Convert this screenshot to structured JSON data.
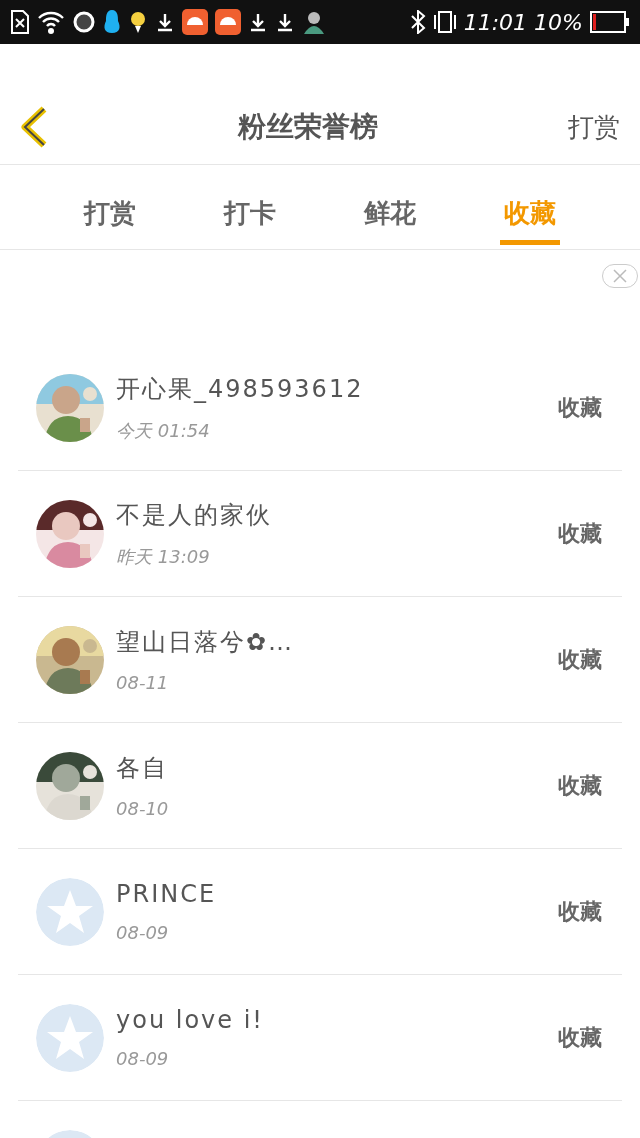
{
  "status_bar": {
    "time": "11:01",
    "battery_text": "10%"
  },
  "header": {
    "title": "粉丝荣誉榜",
    "action": "打赏"
  },
  "tabs": [
    {
      "label": "打赏",
      "selected": false
    },
    {
      "label": "打卡",
      "selected": false
    },
    {
      "label": "鲜花",
      "selected": false
    },
    {
      "label": "收藏",
      "selected": true
    }
  ],
  "fans": [
    {
      "name": "开心果_498593612",
      "time": "今天 01:54",
      "action": "收藏"
    },
    {
      "name": "不是人的家伙",
      "time": "昨天 13:09",
      "action": "收藏"
    },
    {
      "name": "望山日落兮✿…",
      "time": "08-11",
      "action": "收藏"
    },
    {
      "name": "各自",
      "time": "08-10",
      "action": "收藏"
    },
    {
      "kind": "default",
      "name": "PRINCE",
      "time": "08-09",
      "action": "收藏"
    },
    {
      "kind": "default",
      "name": "you love i!",
      "time": "08-09",
      "action": "收藏"
    },
    {
      "kind": "default"
    }
  ]
}
